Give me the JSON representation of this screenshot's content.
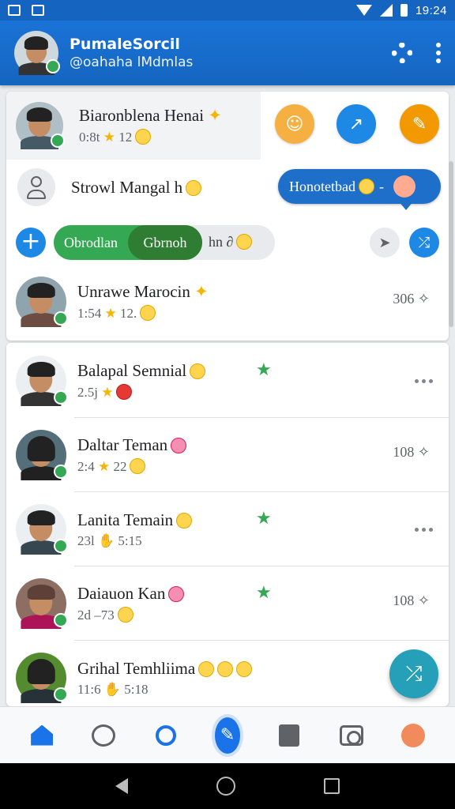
{
  "status_bar": {
    "time": "19:24"
  },
  "header": {
    "title": "PumaleSorcil",
    "subtitle": "@oahaha  lMdmlas"
  },
  "pinned": {
    "name": "Biaronblena Henai",
    "meta_time": "0:8t",
    "meta_count": "12"
  },
  "contact_row": {
    "name": "Strowl Mangal h"
  },
  "message_bubble": {
    "text": "Honotetbad"
  },
  "filter_pills": {
    "segments": [
      "Obrodlan",
      "Gbrnoh"
    ],
    "extra": "hn ∂"
  },
  "suggested": {
    "name": "Unrawe Marocin",
    "meta_time": "1:54",
    "meta_count": "12.",
    "right": "306"
  },
  "list": [
    {
      "name": "Balapal Semnial",
      "meta": "2.5j",
      "right": "more"
    },
    {
      "name": "Daltar Teman",
      "meta": "2:4",
      "meta_count": "22",
      "right": "108"
    },
    {
      "name": "Lanita Temain",
      "meta": "23l",
      "meta_count": "5:15",
      "right": "more"
    },
    {
      "name": "Daiauon Kan",
      "meta": "2d",
      "meta_count": "–73",
      "right": "108"
    },
    {
      "name": "Grihal Temhliima",
      "meta": "11:6",
      "meta_count": "5:18"
    }
  ],
  "colors": {
    "brand_blue": "#1565c0",
    "accent_green": "#34a853",
    "fab_teal": "#26a0b8",
    "action_orange": "#f29900"
  },
  "icons": {
    "nav": [
      "home-icon",
      "chat-icon",
      "search-icon",
      "compose-icon",
      "box-icon",
      "camera-icon",
      "profile-icon"
    ],
    "system": [
      "back-icon",
      "home-circle-icon",
      "recents-icon"
    ]
  }
}
